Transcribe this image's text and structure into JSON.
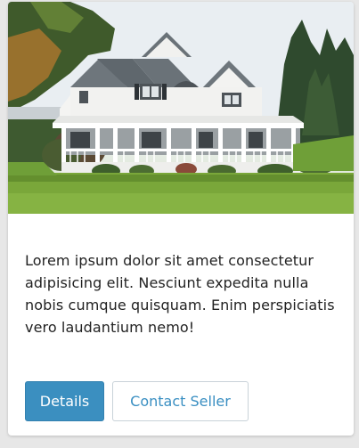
{
  "card": {
    "image_alt": "Large white two-story house with a wraparound porch on a green lawn",
    "text": "Lorem ipsum dolor sit amet consectetur adipisicing elit. Nesciunt expedita nulla nobis cumque quisquam. Enim perspiciatis vero laudantium nemo!",
    "buttons": {
      "details_label": "Details",
      "contact_label": "Contact Seller"
    }
  },
  "colors": {
    "primary": "#3b8fc0",
    "primary_text": "#ffffff",
    "outline_text": "#3a8fc2",
    "outline_border": "#c9d2d9",
    "body_text": "#222222"
  }
}
